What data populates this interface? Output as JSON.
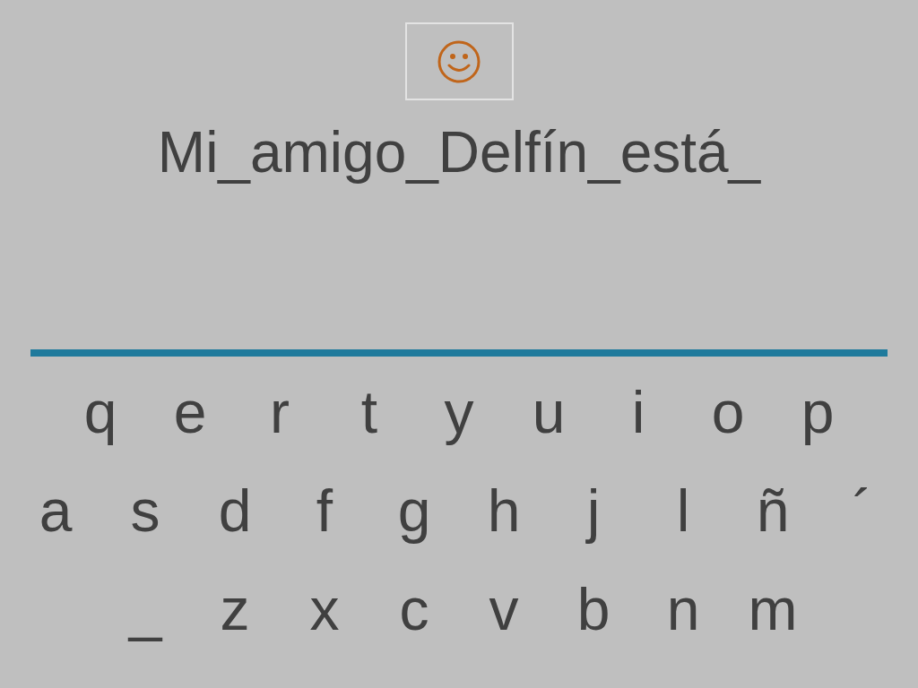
{
  "sentence": "Mi_amigo_Delfín_está_",
  "keyboard": {
    "rows": [
      [
        "q",
        "e",
        "r",
        "t",
        "y",
        "u",
        "i",
        "o",
        "p"
      ],
      [
        "a",
        "s",
        "d",
        "f",
        "g",
        "h",
        "j",
        "l",
        "ñ",
        "´"
      ],
      [
        "_",
        "z",
        "x",
        "c",
        "v",
        "b",
        "n",
        "m"
      ]
    ]
  }
}
